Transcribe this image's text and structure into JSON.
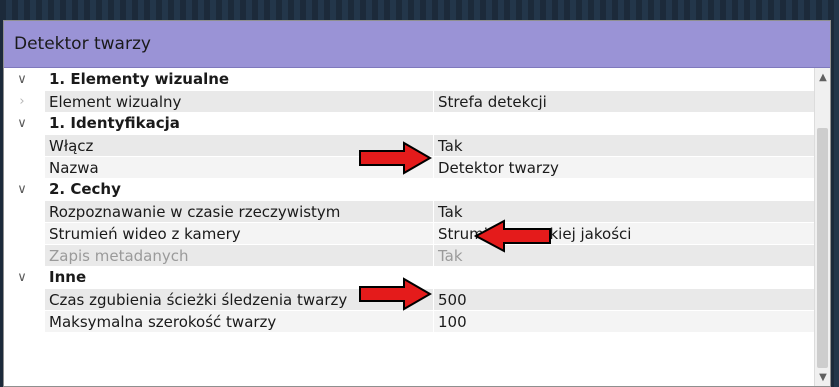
{
  "panel": {
    "title": "Detektor twarzy"
  },
  "rows": [
    {
      "type": "section",
      "label": "1. Elementy wizualne",
      "toggle_icon": "chevron-down"
    },
    {
      "type": "prop",
      "name": "Element wizualny",
      "value": "Strefa detekcji",
      "toggle_icon": "chevron-right"
    },
    {
      "type": "section",
      "label": "1. Identyfikacja",
      "toggle_icon": "chevron-down"
    },
    {
      "type": "prop",
      "name": "Włącz",
      "value": "Tak"
    },
    {
      "type": "prop",
      "name": "Nazwa",
      "value": "Detektor twarzy"
    },
    {
      "type": "section",
      "label": "2. Cechy",
      "toggle_icon": "chevron-down"
    },
    {
      "type": "prop",
      "name": "Rozpoznawanie w czasie rzeczywistym",
      "value": "Tak"
    },
    {
      "type": "prop",
      "name": "Strumień wideo z kamery",
      "value": "Strumień wysokiej jakości"
    },
    {
      "type": "prop",
      "name": "Zapis metadanych",
      "value": "Tak",
      "disabled": true
    },
    {
      "type": "section",
      "label": "Inne",
      "toggle_icon": "chevron-down"
    },
    {
      "type": "prop",
      "name": "Czas zgubienia ścieżki śledzenia twarzy",
      "value": "500"
    },
    {
      "type": "prop",
      "name": "Maksymalna szerokość twarzy",
      "value": "100"
    }
  ],
  "annotations": {
    "arrow_color": "#e41b1b",
    "arrow_outline": "#000000"
  },
  "colors": {
    "title_bar": "#9a93d6",
    "row_bg": "#e9e9e9",
    "disabled_text": "#9a9a9a"
  }
}
